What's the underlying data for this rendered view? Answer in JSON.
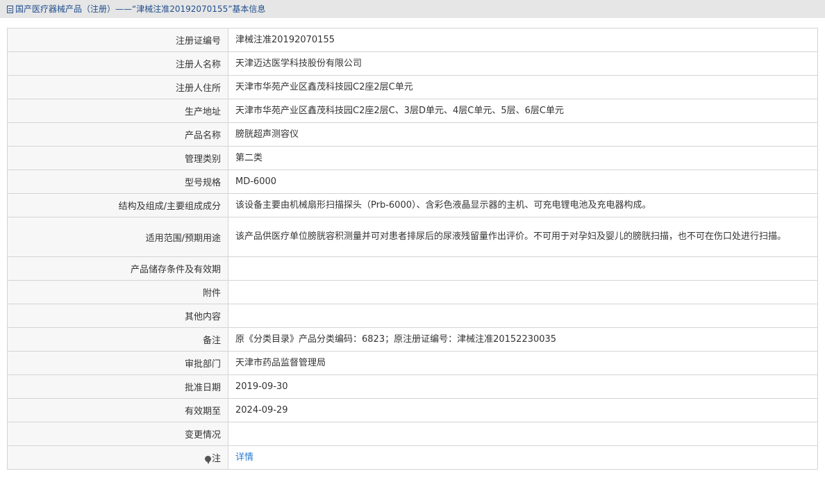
{
  "breadcrumb": {
    "icon": "document-icon",
    "text": "国产医疗器械产品（注册）——“津械注准20192070155”基本信息"
  },
  "rows": [
    {
      "label": "注册证编号",
      "value": "津械注准20192070155"
    },
    {
      "label": "注册人名称",
      "value": "天津迈达医学科技股份有限公司"
    },
    {
      "label": "注册人住所",
      "value": "天津市华苑产业区鑫茂科技园C2座2层C单元"
    },
    {
      "label": "生产地址",
      "value": "天津市华苑产业区鑫茂科技园C2座2层C、3层D单元、4层C单元、5层、6层C单元"
    },
    {
      "label": "产品名称",
      "value": "膀胱超声测容仪"
    },
    {
      "label": "管理类别",
      "value": "第二类"
    },
    {
      "label": "型号规格",
      "value": "MD-6000"
    },
    {
      "label": "结构及组成/主要组成成分",
      "value": "该设备主要由机械扇形扫描探头（Prb-6000）、含彩色液晶显示器的主机、可充电锂电池及充电器构成。"
    },
    {
      "label": "适用范围/预期用途",
      "value": "该产品供医疗单位膀胱容积测量并可对患者排尿后的尿液残留量作出评价。不可用于对孕妇及婴儿的膀胱扫描，也不可在伤口处进行扫描。"
    },
    {
      "label": "产品储存条件及有效期",
      "value": ""
    },
    {
      "label": "附件",
      "value": ""
    },
    {
      "label": "其他内容",
      "value": ""
    },
    {
      "label": "备注",
      "value": "原《分类目录》产品分类编码：6823；原注册证编号：津械注准20152230035"
    },
    {
      "label": "审批部门",
      "value": "天津市药品监督管理局"
    },
    {
      "label": "批准日期",
      "value": "2019-09-30"
    },
    {
      "label": "有效期至",
      "value": "2024-09-29"
    },
    {
      "label": "变更情况",
      "value": ""
    }
  ],
  "note_row": {
    "icon": "pin-icon",
    "label": "注",
    "link": "详情"
  }
}
